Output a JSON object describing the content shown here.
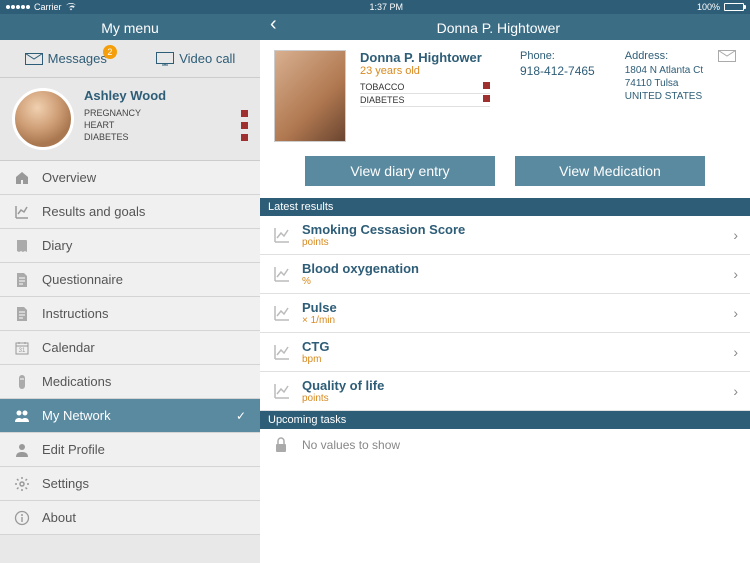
{
  "status": {
    "carrier": "Carrier",
    "time": "1:37 PM",
    "battery": "100%"
  },
  "sidebar": {
    "title": "My menu",
    "actions": {
      "messages_label": "Messages",
      "messages_badge": "2",
      "video_label": "Video call"
    },
    "user": {
      "name": "Ashley Wood",
      "tags": [
        "PREGNANCY",
        "HEART",
        "DIABETES"
      ]
    },
    "menu": [
      {
        "label": "Overview",
        "icon": "home"
      },
      {
        "label": "Results and goals",
        "icon": "chart"
      },
      {
        "label": "Diary",
        "icon": "book"
      },
      {
        "label": "Questionnaire",
        "icon": "document"
      },
      {
        "label": "Instructions",
        "icon": "document"
      },
      {
        "label": "Calendar",
        "icon": "calendar"
      },
      {
        "label": "Medications",
        "icon": "pill"
      },
      {
        "label": "My Network",
        "icon": "people",
        "active": true
      },
      {
        "label": "Edit Profile",
        "icon": "person"
      },
      {
        "label": "Settings",
        "icon": "gear"
      },
      {
        "label": "About",
        "icon": "info"
      }
    ]
  },
  "main": {
    "title": "Donna P. Hightower",
    "patient": {
      "name": "Donna P. Hightower",
      "age": "23 years old",
      "tags": [
        "TOBACCO",
        "DIABETES"
      ],
      "phone_label": "Phone:",
      "phone": "918-412-7465",
      "address_label": "Address:",
      "address_line1": "1804 N Atlanta Ct",
      "address_line2": "74110 Tulsa",
      "address_line3": "UNITED STATES"
    },
    "buttons": {
      "diary": "View diary entry",
      "medication": "View Medication"
    },
    "sections": {
      "results_header": "Latest results",
      "tasks_header": "Upcoming tasks",
      "tasks_empty": "No values to show"
    },
    "results": [
      {
        "name": "Smoking Cessasion Score",
        "unit": "points"
      },
      {
        "name": "Blood oxygenation",
        "unit": "%"
      },
      {
        "name": "Pulse",
        "unit": "× 1/min"
      },
      {
        "name": "CTG",
        "unit": "bpm"
      },
      {
        "name": "Quality of life",
        "unit": "points"
      }
    ]
  }
}
